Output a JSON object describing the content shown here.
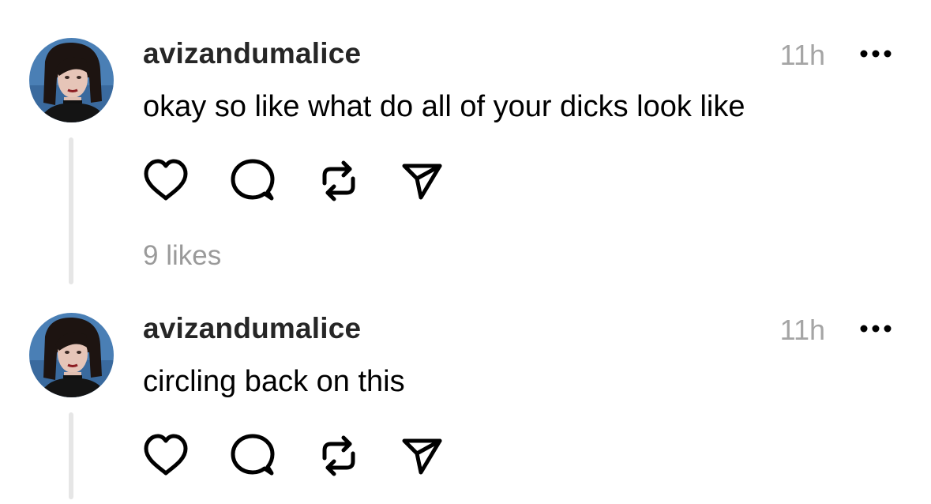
{
  "posts": [
    {
      "username": "avizandumalice",
      "timestamp": "11h",
      "text": "okay so like what do all of your dicks look like",
      "likes": "9 likes",
      "avatar_icon": "profile-photo",
      "actions": [
        "heart-icon",
        "comment-icon",
        "repost-icon",
        "share-icon"
      ],
      "more_icon": "ellipsis-icon"
    },
    {
      "username": "avizandumalice",
      "timestamp": "11h",
      "text": "circling back on this",
      "avatar_icon": "profile-photo",
      "actions": [
        "heart-icon",
        "comment-icon",
        "repost-icon",
        "share-icon"
      ],
      "more_icon": "ellipsis-icon"
    }
  ],
  "colors": {
    "username": "#262626",
    "timestamp": "#a5a5a5",
    "likes": "#9a9a9a",
    "thread_line": "#e6e6e6",
    "icon": "#000000"
  }
}
